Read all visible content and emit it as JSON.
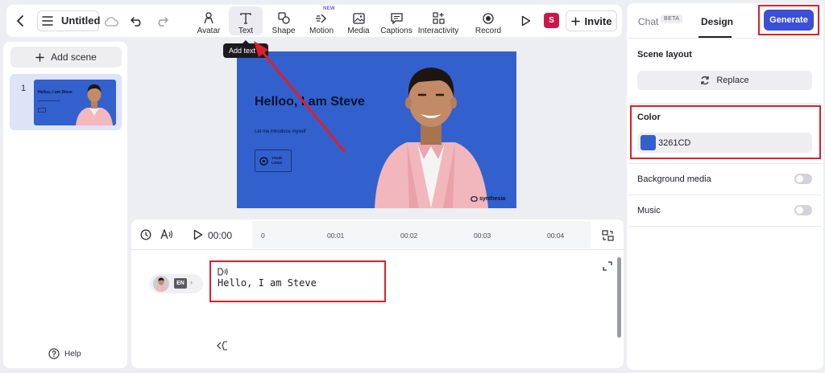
{
  "header": {
    "title": "Untitled",
    "tools": [
      {
        "label": "Avatar",
        "icon": "avatar-icon"
      },
      {
        "label": "Text",
        "icon": "text-icon"
      },
      {
        "label": "Shape",
        "icon": "shape-icon"
      },
      {
        "label": "Motion",
        "icon": "motion-icon"
      },
      {
        "label": "Media",
        "icon": "media-icon"
      },
      {
        "label": "Captions",
        "icon": "captions-icon"
      },
      {
        "label": "Interactivity",
        "icon": "interactivity-icon"
      },
      {
        "label": "Record",
        "icon": "record-icon"
      }
    ],
    "motion_new_tag": "NEW",
    "user_initial": "S",
    "invite_label": "Invite"
  },
  "tooltip": {
    "label": "Add text",
    "shortcut": "T"
  },
  "scenes": {
    "add_label": "Add scene",
    "items": [
      {
        "number": "1",
        "thumb_title": "Helloo, I am Steve"
      }
    ]
  },
  "help_label": "Help",
  "slide": {
    "title": "Helloo, I am Steve",
    "subtitle": "Let me introduce myself",
    "logo_line1": "YOUR",
    "logo_line2": "LOGO",
    "watermark": "synthesia",
    "background_color": "#3261CD"
  },
  "timeline": {
    "time": "00:00",
    "ticks": [
      "0",
      "00:01",
      "00:02",
      "00:03",
      "00:04"
    ]
  },
  "script": {
    "language": "EN",
    "text": "Hello, I am Steve"
  },
  "right_panel": {
    "tabs": {
      "chat": "Chat",
      "chat_badge": "BETA",
      "design": "Design"
    },
    "generate_label": "Generate",
    "scene_layout_label": "Scene layout",
    "replace_label": "Replace",
    "color_label": "Color",
    "color_value": "3261CD",
    "color_hex": "#3261CD",
    "background_media_label": "Background media",
    "background_media_enabled": false,
    "music_label": "Music",
    "music_enabled": false
  },
  "colors": {
    "annotation_red": "#e01e2a",
    "generate_blue": "#3b4fd8",
    "selected_scene": "#dfe3f7"
  }
}
